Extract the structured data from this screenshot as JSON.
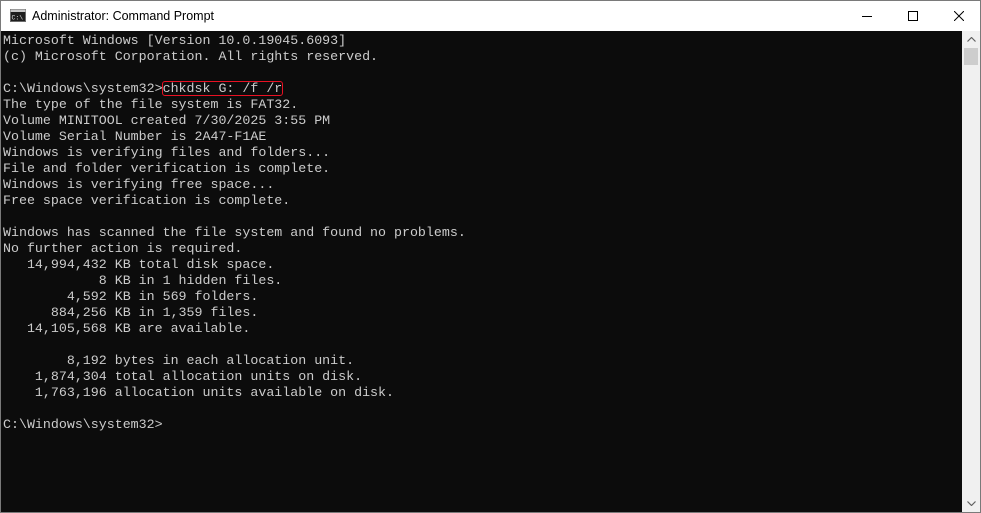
{
  "window": {
    "title": "Administrator: Command Prompt",
    "app_icon_text": "C:\\"
  },
  "console": {
    "lines": [
      "Microsoft Windows [Version 10.0.19045.6093]",
      "(c) Microsoft Corporation. All rights reserved.",
      "",
      "",
      "The type of the file system is FAT32.",
      "Volume MINITOOL created 7/30/2025 3:55 PM",
      "Volume Serial Number is 2A47-F1AE",
      "Windows is verifying files and folders...",
      "File and folder verification is complete.",
      "Windows is verifying free space...",
      "Free space verification is complete.",
      "",
      "Windows has scanned the file system and found no problems.",
      "No further action is required.",
      "   14,994,432 KB total disk space.",
      "            8 KB in 1 hidden files.",
      "        4,592 KB in 569 folders.",
      "      884,256 KB in 1,359 files.",
      "   14,105,568 KB are available.",
      "",
      "        8,192 bytes in each allocation unit.",
      "    1,874,304 total allocation units on disk.",
      "    1,763,196 allocation units available on disk.",
      "",
      "C:\\Windows\\system32>"
    ],
    "command_prompt": "C:\\Windows\\system32>",
    "command": "chkdsk G: /f /r"
  },
  "colors": {
    "console_bg": "#0c0c0c",
    "console_text": "#cccccc",
    "highlight_box": "#e81123",
    "titlebar_bg": "#ffffff"
  },
  "icons": {
    "app": "cmd-icon",
    "minimize": "minimize-icon",
    "maximize": "maximize-icon",
    "close": "close-icon",
    "scroll_up": "scroll-up-arrow-icon",
    "scroll_down": "scroll-down-arrow-icon"
  }
}
